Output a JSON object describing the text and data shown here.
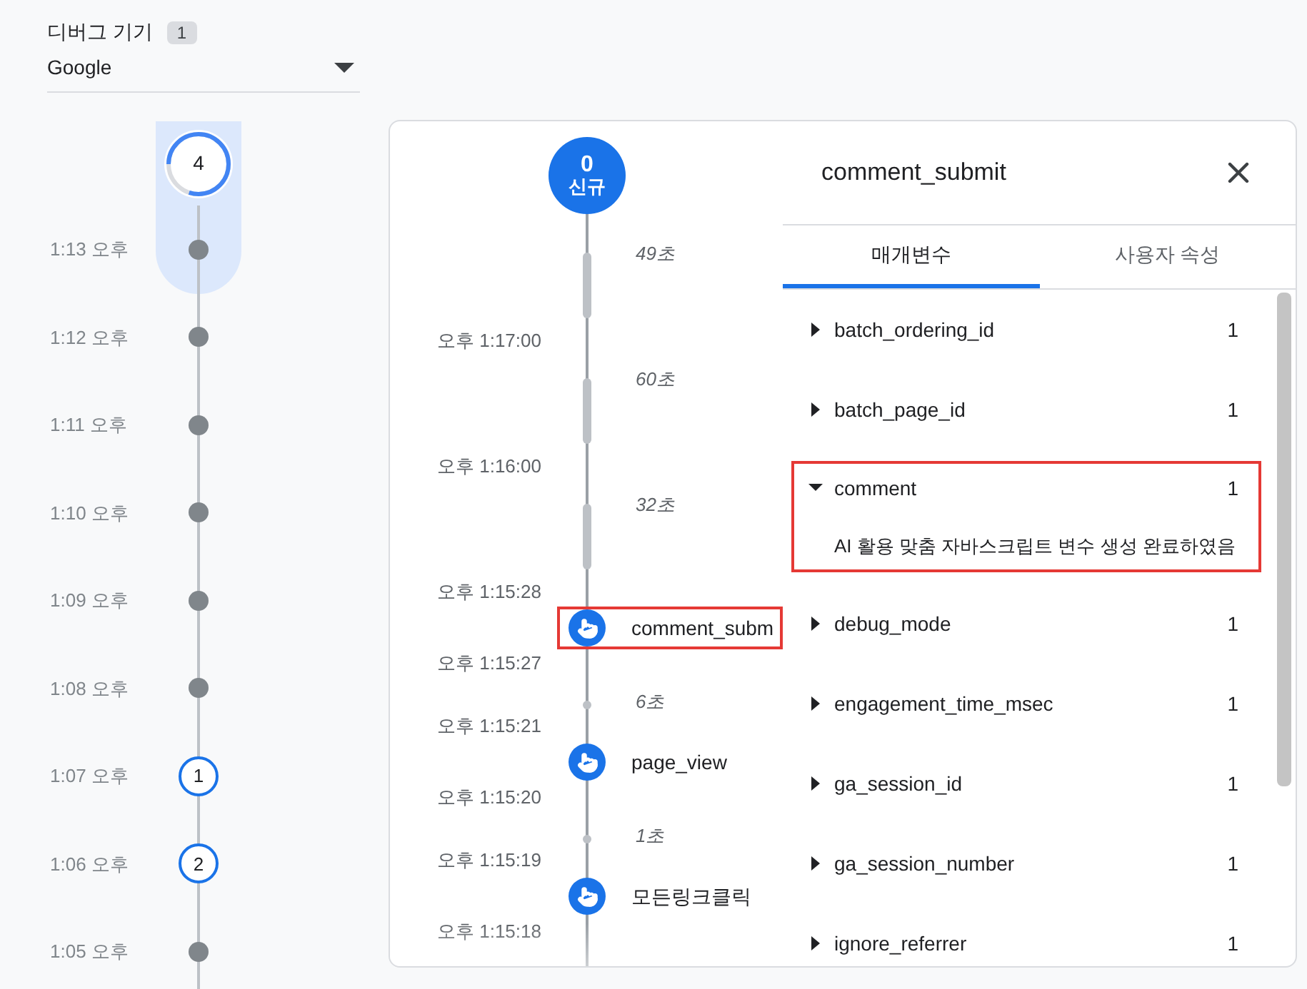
{
  "device_picker": {
    "label": "디버그 기기",
    "count": "1",
    "value": "Google"
  },
  "minutes_timeline": {
    "current_count": "4",
    "level": 0.8,
    "minutes": [
      {
        "time": "1:13 오후",
        "kind": "dot",
        "selected": true
      },
      {
        "time": "1:12 오후",
        "kind": "dot",
        "selected": false
      },
      {
        "time": "1:11 오후",
        "kind": "dot",
        "selected": false
      },
      {
        "time": "1:10 오후",
        "kind": "dot",
        "selected": false
      },
      {
        "time": "1:09 오후",
        "kind": "dot",
        "selected": false
      },
      {
        "time": "1:08 오후",
        "kind": "dot",
        "selected": false
      },
      {
        "time": "1:07 오후",
        "kind": "count",
        "count": "1",
        "selected": false
      },
      {
        "time": "1:06 오후",
        "kind": "count",
        "count": "2",
        "selected": false
      },
      {
        "time": "1:05 오후",
        "kind": "dot",
        "selected": false
      }
    ]
  },
  "seconds_timeline": {
    "top_count": "0",
    "top_label": "신규",
    "entries": [
      {
        "kind": "gap",
        "label": "49초"
      },
      {
        "kind": "time",
        "label": "오후 1:17:00"
      },
      {
        "kind": "gap",
        "label": "60초"
      },
      {
        "kind": "time",
        "label": "오후 1:16:00"
      },
      {
        "kind": "gap",
        "label": "32초"
      },
      {
        "kind": "time",
        "label": "오후 1:15:28"
      },
      {
        "kind": "event",
        "label": "comment_subm",
        "selected": true
      },
      {
        "kind": "time",
        "label": "오후 1:15:27"
      },
      {
        "kind": "blip",
        "label": "6초"
      },
      {
        "kind": "time",
        "label": "오후 1:15:21"
      },
      {
        "kind": "event",
        "label": "page_view",
        "selected": false
      },
      {
        "kind": "time",
        "label": "오후 1:15:20"
      },
      {
        "kind": "blip",
        "label": "1초"
      },
      {
        "kind": "time",
        "label": "오후 1:15:19"
      },
      {
        "kind": "event",
        "label": "모든링크클릭",
        "selected": false
      },
      {
        "kind": "time",
        "label": "오후 1:15:18"
      }
    ]
  },
  "event_panel": {
    "title": "comment_submit",
    "tabs": [
      {
        "label": "매개변수",
        "selected": true
      },
      {
        "label": "사용자 속성",
        "selected": false
      }
    ],
    "parameters": [
      {
        "name": "batch_ordering_id",
        "count": "1",
        "expanded": false,
        "selected": false
      },
      {
        "name": "batch_page_id",
        "count": "1",
        "expanded": false,
        "selected": false
      },
      {
        "name": "comment",
        "count": "1",
        "expanded": true,
        "selected": true,
        "value": "AI 활용 맞춤 자바스크립트 변수 생성 완료하였음"
      },
      {
        "name": "debug_mode",
        "count": "1",
        "expanded": false,
        "selected": false
      },
      {
        "name": "engagement_time_msec",
        "count": "1",
        "expanded": false,
        "selected": false
      },
      {
        "name": "ga_session_id",
        "count": "1",
        "expanded": false,
        "selected": false
      },
      {
        "name": "ga_session_number",
        "count": "1",
        "expanded": false,
        "selected": false
      },
      {
        "name": "ignore_referrer",
        "count": "1",
        "expanded": false,
        "selected": false
      }
    ]
  }
}
